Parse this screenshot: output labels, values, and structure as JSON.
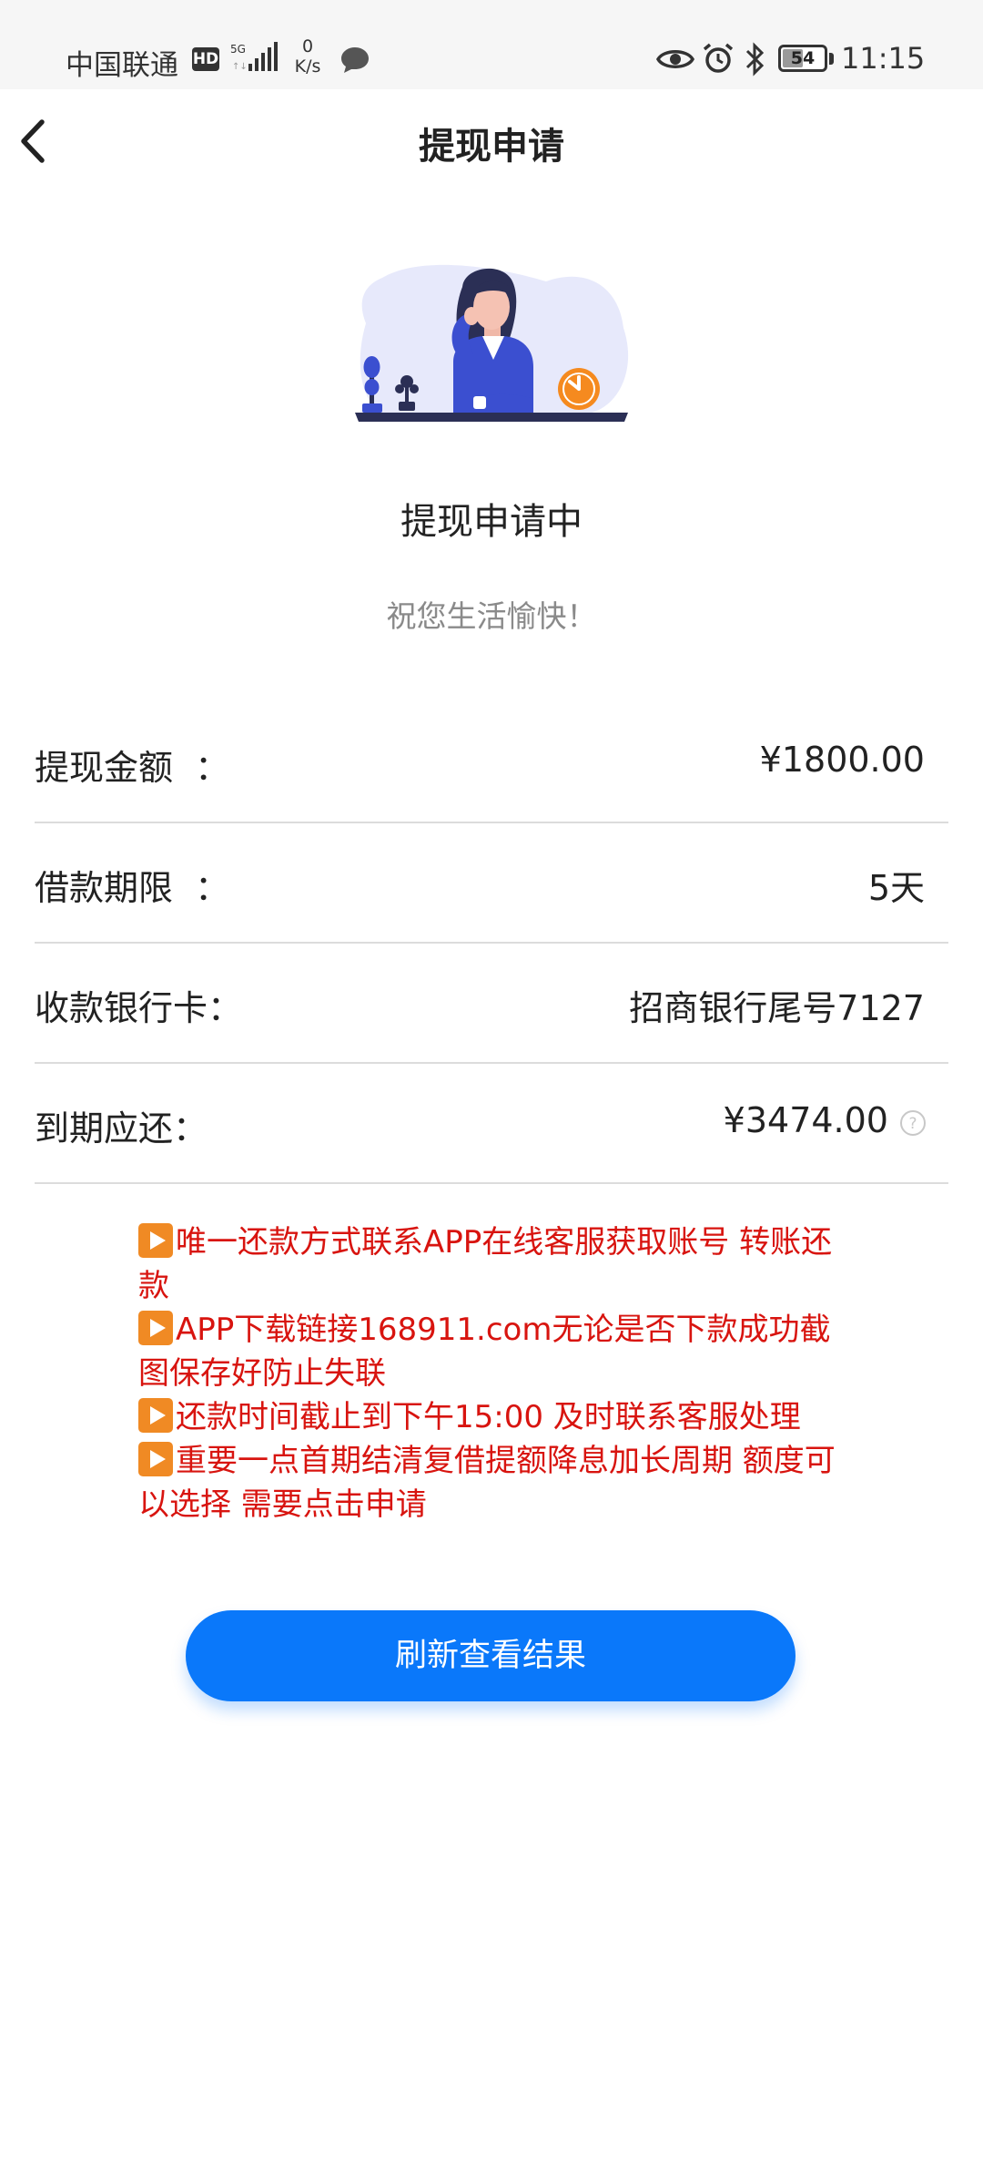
{
  "status_bar": {
    "carrier": "中国联通",
    "hd_badge": "HD",
    "network": "5G",
    "speed_value": "0",
    "speed_unit": "K/s",
    "battery": "54",
    "battery_fraction": 0.54,
    "time": "11:15",
    "icons": [
      "chat-bubble-icon",
      "eye-icon",
      "alarm-icon",
      "bluetooth-icon",
      "battery-icon"
    ]
  },
  "header": {
    "back_icon": "chevron-left-icon",
    "title": "提现申请"
  },
  "status": {
    "title": "提现申请中",
    "subtitle": "祝您生活愉快！"
  },
  "details": [
    {
      "label": "提现金额  ：",
      "value": "¥1800.00"
    },
    {
      "label": "借款期限  ：",
      "value": "5天"
    },
    {
      "label": "收款银行卡：",
      "value": "招商银行尾号7127"
    },
    {
      "label": "到期应还：",
      "value": "¥3474.00"
    }
  ],
  "notice": {
    "color": "#d8140f",
    "items": [
      "唯一还款方式联系APP在线客服获取账号  转账还款",
      "APP下载链接168911.com无论是否下款成功截图保存好防止失联",
      "还款时间截止到下午15:00 及时联系客服处理",
      "重要一点首期结清复借提额降息加长周期 额度可以选择 需要点击申请"
    ]
  },
  "actions": {
    "refresh_label": "刷新查看结果",
    "accent_color": "#0a78fa"
  }
}
